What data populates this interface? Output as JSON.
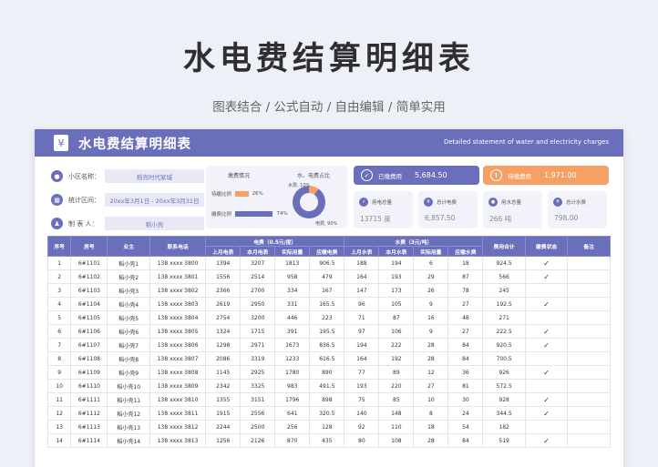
{
  "page": {
    "title": "水电费结算明细表",
    "subtitle": "图表结合 / 公式自动 / 自由编辑 / 简单实用"
  },
  "sheet": {
    "title": "水电费结算明细表",
    "subtitle_en": "Detailed statement of water and electricity charges",
    "info": [
      {
        "label": "小区名称：",
        "value": "稻壳时代家城",
        "icon": "location-icon"
      },
      {
        "label": "统计区间：",
        "value": "20xx年3月1日 - 20xx年3月31日",
        "icon": "chart-icon"
      },
      {
        "label": "制 表 人：",
        "value": "稻小壳",
        "icon": "person-icon"
      }
    ],
    "ratio_card": {
      "pay_title": "缴费情况",
      "unpaid_label": "待缴比例",
      "unpaid_pct": "26%",
      "unpaid_value": 26,
      "paid_label": "缴费比例",
      "paid_pct": "74%",
      "paid_value": 74,
      "donut_title": "水、电费占比",
      "water_label": "水费, 10%",
      "water_value": 10,
      "elec_label": "电费, 90%",
      "elec_value": 90
    },
    "paid": {
      "label": "已缴费用",
      "amount": "5,684.50"
    },
    "pending": {
      "label": "待缴费用",
      "amount": "1,971.00"
    },
    "mini_cards": [
      {
        "label": "用电总量",
        "value": "13715 度",
        "icon": "plug-icon"
      },
      {
        "label": "总计电费",
        "value": "6,857.50",
        "icon": "yen-icon"
      },
      {
        "label": "用水总量",
        "value": "266 吨",
        "icon": "drop-icon"
      },
      {
        "label": "总计水费",
        "value": "798.00",
        "icon": "yen-icon"
      }
    ],
    "colors": {
      "accent": "#6a6fbc",
      "paid": "#6a6fbc",
      "pending": "#f5a165",
      "unpaid_bar": "#f5a165"
    },
    "table": {
      "head_top": [
        "序号",
        "房号",
        "业主",
        "联系电话",
        "电费（0.5元/度）",
        "水费（3元/吨）",
        "费用合计",
        "缴费状态",
        "备注"
      ],
      "head_sub": [
        "上月电表",
        "本月电表",
        "实际用量",
        "应缴电费",
        "上月水表",
        "本月水表",
        "实际用量",
        "应缴水费"
      ],
      "rows": [
        [
          "1",
          "6#1101",
          "稻小壳1",
          "138 xxxx 3800",
          "1394",
          "3207",
          "1813",
          "906.5",
          "188",
          "194",
          "6",
          "18",
          "924.5",
          "✓",
          ""
        ],
        [
          "2",
          "6#1102",
          "稻小壳2",
          "138 xxxx 3801",
          "1556",
          "2514",
          "958",
          "479",
          "164",
          "193",
          "29",
          "87",
          "566",
          "✓",
          ""
        ],
        [
          "3",
          "6#1103",
          "稻小壳3",
          "138 xxxx 3802",
          "2366",
          "2700",
          "334",
          "167",
          "147",
          "173",
          "26",
          "78",
          "245",
          "",
          ""
        ],
        [
          "4",
          "6#1104",
          "稻小壳4",
          "138 xxxx 3803",
          "2619",
          "2950",
          "331",
          "165.5",
          "96",
          "105",
          "9",
          "27",
          "192.5",
          "✓",
          ""
        ],
        [
          "5",
          "6#1105",
          "稻小壳5",
          "138 xxxx 3804",
          "2754",
          "3200",
          "446",
          "223",
          "71",
          "87",
          "16",
          "48",
          "271",
          "",
          ""
        ],
        [
          "6",
          "6#1106",
          "稻小壳6",
          "138 xxxx 3805",
          "1324",
          "1715",
          "391",
          "195.5",
          "97",
          "106",
          "9",
          "27",
          "222.5",
          "✓",
          ""
        ],
        [
          "7",
          "6#1107",
          "稻小壳7",
          "138 xxxx 3806",
          "1298",
          "2971",
          "1673",
          "836.5",
          "194",
          "222",
          "28",
          "84",
          "920.5",
          "✓",
          ""
        ],
        [
          "8",
          "6#1108",
          "稻小壳8",
          "138 xxxx 3807",
          "2086",
          "3319",
          "1233",
          "616.5",
          "164",
          "192",
          "28",
          "84",
          "700.5",
          "",
          ""
        ],
        [
          "9",
          "6#1109",
          "稻小壳9",
          "138 xxxx 3808",
          "1145",
          "2925",
          "1780",
          "890",
          "77",
          "89",
          "12",
          "36",
          "926",
          "✓",
          ""
        ],
        [
          "10",
          "6#1110",
          "稻小壳10",
          "138 xxxx 3809",
          "2342",
          "3325",
          "983",
          "491.5",
          "193",
          "220",
          "27",
          "81",
          "572.5",
          "",
          ""
        ],
        [
          "11",
          "6#1111",
          "稻小壳11",
          "138 xxxx 3810",
          "1355",
          "3151",
          "1796",
          "898",
          "75",
          "85",
          "10",
          "30",
          "928",
          "✓",
          ""
        ],
        [
          "12",
          "6#1112",
          "稻小壳12",
          "138 xxxx 3811",
          "1915",
          "2556",
          "641",
          "320.5",
          "140",
          "148",
          "8",
          "24",
          "344.5",
          "✓",
          ""
        ],
        [
          "13",
          "6#1113",
          "稻小壳13",
          "138 xxxx 3812",
          "2244",
          "2500",
          "256",
          "128",
          "92",
          "110",
          "18",
          "54",
          "182",
          "",
          ""
        ],
        [
          "14",
          "6#1114",
          "稻小壳14",
          "138 xxxx 3813",
          "1256",
          "2126",
          "870",
          "435",
          "80",
          "108",
          "28",
          "84",
          "519",
          "✓",
          ""
        ]
      ]
    }
  }
}
